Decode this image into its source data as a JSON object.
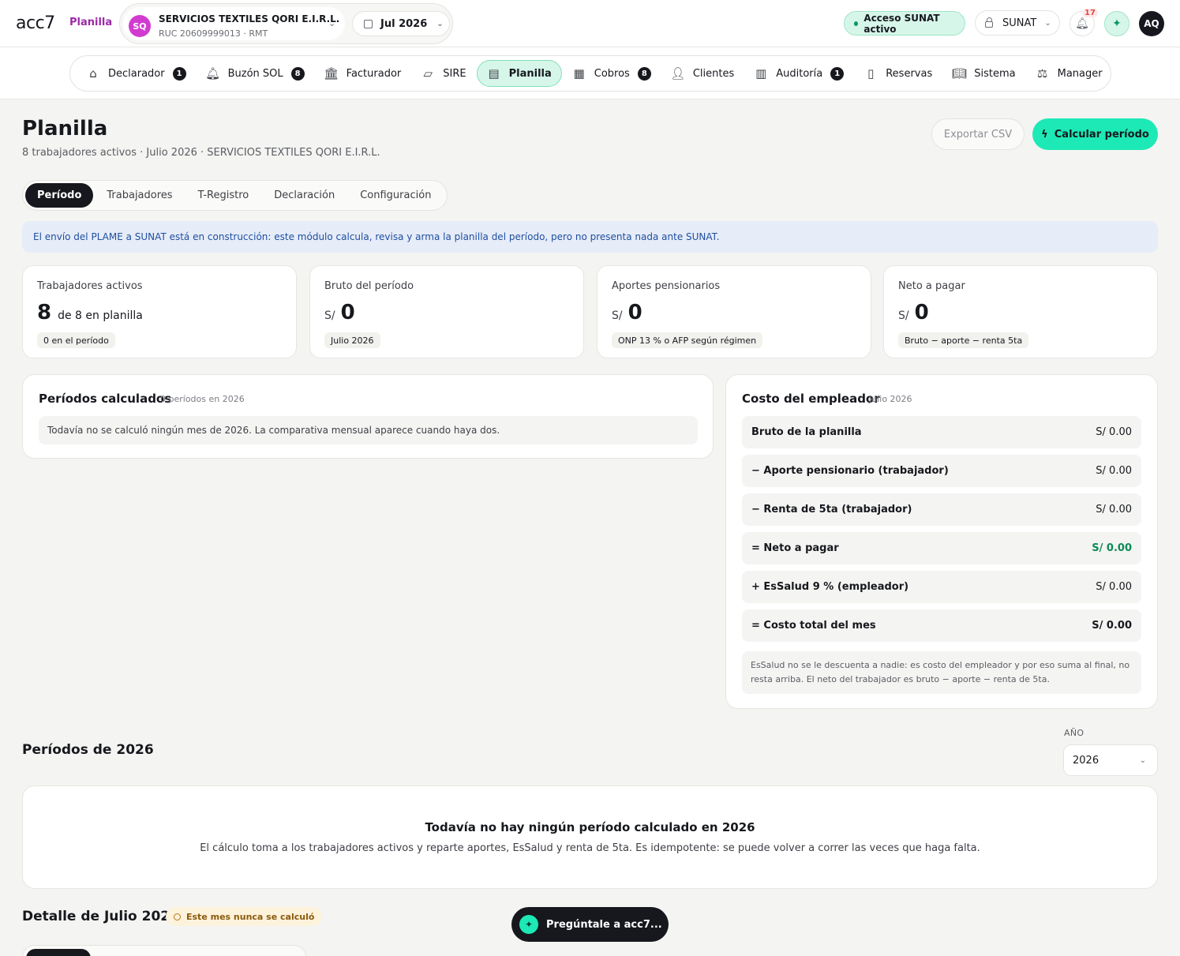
{
  "header": {
    "logo": "acc7",
    "breadcrumb": "Planilla",
    "company": {
      "initials": "SQ",
      "name": "SERVICIOS TEXTILES QORI E.I.R.L.",
      "ruc": "RUC 20609999013 · RMT"
    },
    "period": "Jul 2026",
    "sunat_status": "Acceso SUNAT activo",
    "sunat_button": "SUNAT",
    "notifications_count": "17",
    "user_initials": "AQ"
  },
  "nav": {
    "items": [
      {
        "label": "Declarador",
        "badge": "1",
        "icon": "home-icon"
      },
      {
        "label": "Buzón SOL",
        "badge": "8",
        "icon": "bell-icon"
      },
      {
        "label": "Facturador",
        "badge": "",
        "icon": "bank-icon"
      },
      {
        "label": "SIRE",
        "badge": "",
        "icon": "tag-icon"
      },
      {
        "label": "Planilla",
        "badge": "",
        "icon": "payroll-icon"
      },
      {
        "label": "Cobros",
        "badge": "8",
        "icon": "calendar-icon"
      },
      {
        "label": "Clientes",
        "badge": "",
        "icon": "user-icon"
      },
      {
        "label": "Auditoría",
        "badge": "1",
        "icon": "chart-icon"
      },
      {
        "label": "Reservas",
        "badge": "",
        "icon": "document-icon"
      },
      {
        "label": "Sistema",
        "badge": "",
        "icon": "book-icon"
      },
      {
        "label": "Manager",
        "badge": "",
        "icon": "scale-icon"
      }
    ],
    "active": "Planilla"
  },
  "page": {
    "title": "Planilla",
    "subtitle": "8 trabajadores activos · Julio 2026 · SERVICIOS TEXTILES QORI E.I.R.L.",
    "export_label": "Exportar CSV",
    "calc_label": "Calcular período",
    "tabs": [
      "Período",
      "Trabajadores",
      "T-Registro",
      "Declaración",
      "Configuración"
    ],
    "notice": "El envío del PLAME a SUNAT está en construcción: este módulo calcula, revisa y arma la planilla del período, pero no presenta nada ante SUNAT."
  },
  "kpis": [
    {
      "label": "Trabajadores activos",
      "prefix": "",
      "value": "8",
      "suffix": "de 8 en planilla",
      "chip": "0 en el período"
    },
    {
      "label": "Bruto del período",
      "prefix": "S/",
      "value": "0",
      "suffix": "",
      "chip": "Julio 2026"
    },
    {
      "label": "Aportes pensionarios",
      "prefix": "S/",
      "value": "0",
      "suffix": "",
      "chip": "ONP 13 % o AFP según régimen"
    },
    {
      "label": "Neto a pagar",
      "prefix": "S/",
      "value": "0",
      "suffix": "",
      "chip": "Bruto − aporte − renta 5ta"
    }
  ],
  "periodos_card": {
    "title": "Períodos calculados",
    "meta": "0 períodos en 2026",
    "empty": "Todavía no se calculó ningún mes de 2026. La comparativa mensual aparece cuando haya dos."
  },
  "costo_card": {
    "title": "Costo del empleador",
    "meta": "Julio 2026",
    "rows": [
      {
        "label": "Bruto de la planilla",
        "value": "S/ 0.00"
      },
      {
        "label": "− Aporte pensionario (trabajador)",
        "value": "S/ 0.00"
      },
      {
        "label": "− Renta de 5ta (trabajador)",
        "value": "S/ 0.00"
      },
      {
        "label": "= Neto a pagar",
        "value": "S/ 0.00"
      },
      {
        "label": "+ EsSalud 9 % (empleador)",
        "value": "S/ 0.00"
      },
      {
        "label": "= Costo total del mes",
        "value": "S/ 0.00"
      }
    ],
    "note": "EsSalud no se le descuenta a nadie: es costo del empleador y por eso suma al final, no resta arriba. El neto del trabajador es bruto − aporte − renta de 5ta."
  },
  "periodos_section": {
    "title": "Períodos de 2026",
    "year_label": "AÑO",
    "year_value": "2026",
    "empty_title": "Todavía no hay ningún período calculado en 2026",
    "empty_desc": "El cálculo toma a los trabajadores activos y reparte aportes, EsSalud y renta de 5ta. Es idempotente: se puede volver a correr las veces que haga falta."
  },
  "detalle": {
    "title": "Detalle de Julio 2026",
    "warning": "Este mes nunca se calculó"
  },
  "assistant": {
    "label": "Pregúntale a acc7..."
  }
}
